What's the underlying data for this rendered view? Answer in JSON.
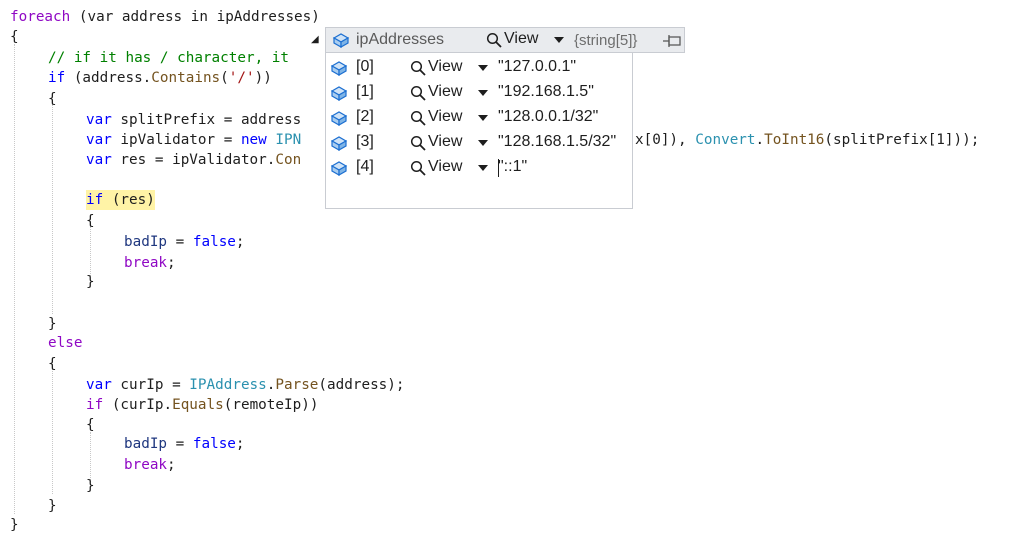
{
  "code": {
    "line1": {
      "kw": "foreach",
      "rest": " (var address in ipAddresses)"
    },
    "line2": "{",
    "line3": "// if it has / character, it",
    "line4": {
      "kw": "if",
      "a": " (address.",
      "m": "Contains",
      "b": "(",
      "s": "'/'",
      "c": "))"
    },
    "line5": "{",
    "line6": {
      "kw": "var",
      "rest": " splitPrefix = address"
    },
    "line7": {
      "kw": "var",
      "a": " ipValidator = ",
      "kw2": "new",
      "ty": " IPN"
    },
    "line7_right": {
      "a": "x[0]), ",
      "ty": "Convert",
      "b": ".",
      "m": "ToInt16",
      "c": "(splitPrefix[1]));"
    },
    "line8": {
      "kw": "var",
      "a": " res = ipValidator.",
      "m": "Con"
    },
    "line9": {
      "kw": "if",
      "rest": " (res)"
    },
    "line10": "{",
    "line11": {
      "v": "badIp",
      "a": " = ",
      "kw2": "false",
      "b": ";"
    },
    "line12": {
      "kw": "break",
      "b": ";"
    },
    "line13": "}",
    "line14": "}",
    "line15": {
      "kw": "else"
    },
    "line16": "{",
    "line17": {
      "kw": "var",
      "a": " curIp = ",
      "ty": "IPAddress",
      "b": ".",
      "m": "Parse",
      "c": "(address);"
    },
    "line18": {
      "kw": "if",
      "a": " (curIp.",
      "m": "Equals",
      "b": "(remoteIp))"
    },
    "line19": "{",
    "line20": {
      "v": "badIp",
      "a": " = ",
      "kw2": "false",
      "b": ";"
    },
    "line21": {
      "kw": "break",
      "b": ";"
    },
    "line22": "}",
    "line23": "}",
    "line24": "}"
  },
  "datatip": {
    "name": "ipAddresses",
    "view_label": "View",
    "type": "{string[5]}",
    "items": [
      {
        "index": "[0]",
        "value": "\"127.0.0.1\""
      },
      {
        "index": "[1]",
        "value": "\"192.168.1.5\""
      },
      {
        "index": "[2]",
        "value": "\"128.0.0.1/32\""
      },
      {
        "index": "[3]",
        "value": "\"128.168.1.5/32\""
      },
      {
        "index": "[4]",
        "value": "\"::1\""
      }
    ]
  },
  "colors": {
    "keyword": "#8f08c4",
    "keyword_blue": "#0000ff",
    "comment": "#008000",
    "type": "#2b91af",
    "highlight": "#fff3a6"
  }
}
